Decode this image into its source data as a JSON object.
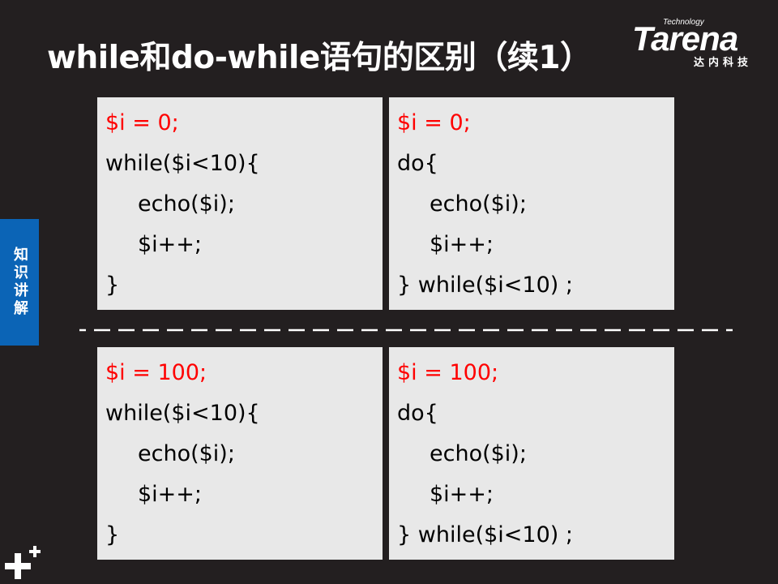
{
  "slide": {
    "title": "while和do-while语句的区别（续1）"
  },
  "logo": {
    "tech": "Technology",
    "brand": "Tarena",
    "sub": "达内科技"
  },
  "side_tab": {
    "label": "知识讲解"
  },
  "boxes": {
    "top_left": [
      "$i = 0;",
      "while($i<10){",
      "echo($i);",
      "$i++;",
      "}"
    ],
    "top_right": [
      "$i = 0;",
      "do{",
      "echo($i);",
      "$i++;",
      "} while($i<10) ;"
    ],
    "bottom_left": [
      "$i = 100;",
      "while($i<10){",
      "echo($i);",
      "$i++;",
      "}"
    ],
    "bottom_right": [
      "$i = 100;",
      "do{",
      "echo($i);",
      "$i++;",
      "} while($i<10) ;"
    ]
  },
  "colors": {
    "background": "#231f20",
    "code_box": "#e8e8e8",
    "highlight": "#ff0000",
    "side_tab": "#0b64b6"
  }
}
